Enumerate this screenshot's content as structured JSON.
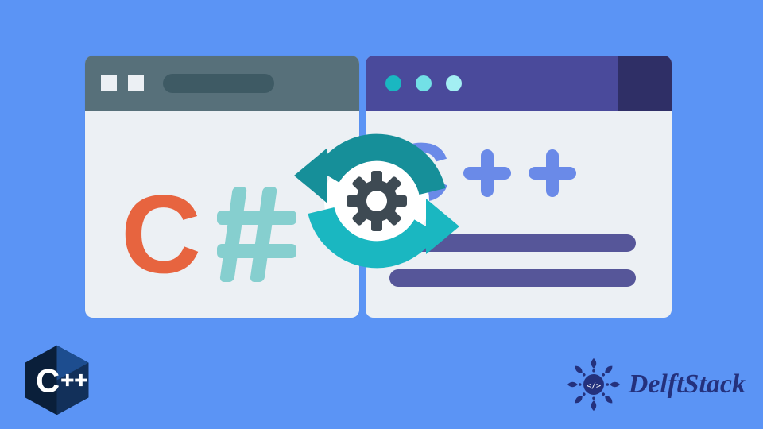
{
  "illustration": {
    "left_window": {
      "language_label": "C#",
      "letter": "C"
    },
    "right_window": {
      "language_label": "C++",
      "letter": "C"
    },
    "concept": "convert-between-csharp-and-cpp"
  },
  "badge": {
    "label": "C++",
    "letter": "C"
  },
  "brand": {
    "name": "DelftStack"
  },
  "colors": {
    "background": "#5b94f5",
    "orange": "#e7643f",
    "teal": "#86cfcf",
    "cycle_dark": "#168f99",
    "cycle_light": "#1ab7c1",
    "purple": "#4a4a9b",
    "blue_soft": "#6a8ae8",
    "navy": "#24317d"
  }
}
